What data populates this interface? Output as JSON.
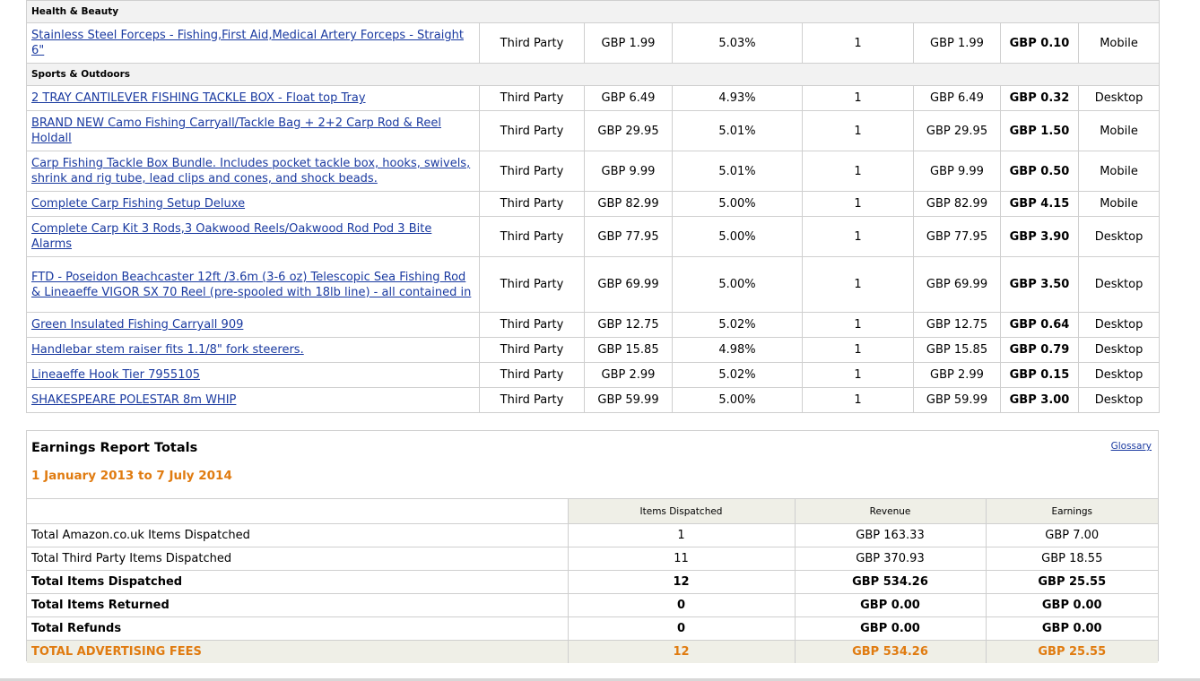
{
  "categories": [
    {
      "name": "Health & Beauty",
      "items": [
        {
          "title": "Stainless Steel Forceps - Fishing,First Aid,Medical Artery Forceps - Straight 6\"",
          "seller": "Third Party",
          "price": "GBP 1.99",
          "rate": "5.03%",
          "qty": "1",
          "revenue": "GBP 1.99",
          "earnings": "GBP 0.10",
          "device": "Mobile"
        }
      ]
    },
    {
      "name": "Sports & Outdoors",
      "items": [
        {
          "title": "2 TRAY CANTILEVER FISHING TACKLE BOX - Float top Tray",
          "seller": "Third Party",
          "price": "GBP 6.49",
          "rate": "4.93%",
          "qty": "1",
          "revenue": "GBP 6.49",
          "earnings": "GBP 0.32",
          "device": "Desktop"
        },
        {
          "title": "BRAND NEW Camo Fishing Carryall/Tackle Bag + 2+2 Carp Rod & Reel Holdall",
          "seller": "Third Party",
          "price": "GBP 29.95",
          "rate": "5.01%",
          "qty": "1",
          "revenue": "GBP 29.95",
          "earnings": "GBP 1.50",
          "device": "Mobile"
        },
        {
          "title": "Carp Fishing Tackle Box Bundle. Includes pocket tackle box, hooks, swivels, shrink and rig tube, lead clips and cones, and shock beads.",
          "seller": "Third Party",
          "price": "GBP 9.99",
          "rate": "5.01%",
          "qty": "1",
          "revenue": "GBP 9.99",
          "earnings": "GBP 0.50",
          "device": "Mobile"
        },
        {
          "title": "Complete Carp Fishing Setup Deluxe",
          "seller": "Third Party",
          "price": "GBP 82.99",
          "rate": "5.00%",
          "qty": "1",
          "revenue": "GBP 82.99",
          "earnings": "GBP 4.15",
          "device": "Mobile"
        },
        {
          "title": "Complete Carp Kit 3 Rods,3 Oakwood Reels/Oakwood Rod Pod 3 Bite Alarms",
          "seller": "Third Party",
          "price": "GBP 77.95",
          "rate": "5.00%",
          "qty": "1",
          "revenue": "GBP 77.95",
          "earnings": "GBP 3.90",
          "device": "Desktop"
        },
        {
          "title": "FTD - Poseidon Beachcaster 12ft /3.6m (3-6 oz) Telescopic Sea Fishing Rod & Lineaeffe VIGOR SX 70 Reel (pre-spooled with 18lb line) - all contained in",
          "seller": "Third Party",
          "price": "GBP 69.99",
          "rate": "5.00%",
          "qty": "1",
          "revenue": "GBP 69.99",
          "earnings": "GBP 3.50",
          "device": "Desktop"
        },
        {
          "title": "Green Insulated Fishing Carryall 909",
          "seller": "Third Party",
          "price": "GBP 12.75",
          "rate": "5.02%",
          "qty": "1",
          "revenue": "GBP 12.75",
          "earnings": "GBP 0.64",
          "device": "Desktop"
        },
        {
          "title": "Handlebar stem raiser fits 1.1/8\" fork steerers.",
          "seller": "Third Party",
          "price": "GBP 15.85",
          "rate": "4.98%",
          "qty": "1",
          "revenue": "GBP 15.85",
          "earnings": "GBP 0.79",
          "device": "Desktop"
        },
        {
          "title": "Lineaeffe Hook Tier 7955105",
          "seller": "Third Party",
          "price": "GBP 2.99",
          "rate": "5.02%",
          "qty": "1",
          "revenue": "GBP 2.99",
          "earnings": "GBP 0.15",
          "device": "Desktop"
        },
        {
          "title": "SHAKESPEARE POLESTAR 8m WHIP",
          "seller": "Third Party",
          "price": "GBP 59.99",
          "rate": "5.00%",
          "qty": "1",
          "revenue": "GBP 59.99",
          "earnings": "GBP 3.00",
          "device": "Desktop"
        }
      ]
    }
  ],
  "totals": {
    "title": "Earnings Report Totals",
    "date_range": "1 January 2013 to 7 July 2014",
    "glossary_label": "Glossary",
    "headers": [
      "",
      "Items Dispatched",
      "Revenue",
      "Earnings"
    ],
    "rows": [
      {
        "label": "Total Amazon.co.uk Items Dispatched",
        "items": "1",
        "revenue": "GBP 163.33",
        "earnings": "GBP 7.00",
        "style": "normal"
      },
      {
        "label": "Total Third Party Items Dispatched",
        "items": "11",
        "revenue": "GBP 370.93",
        "earnings": "GBP 18.55",
        "style": "normal"
      },
      {
        "label": "Total Items Dispatched",
        "items": "12",
        "revenue": "GBP 534.26",
        "earnings": "GBP 25.55",
        "style": "bold"
      },
      {
        "label": "Total Items Returned",
        "items": "0",
        "revenue": "GBP 0.00",
        "earnings": "GBP 0.00",
        "style": "bold"
      },
      {
        "label": "Total Refunds",
        "items": "0",
        "revenue": "GBP 0.00",
        "earnings": "GBP 0.00",
        "style": "bold"
      },
      {
        "label": "TOTAL ADVERTISING FEES",
        "items": "12",
        "revenue": "GBP 534.26",
        "earnings": "GBP 25.55",
        "style": "adfees"
      }
    ]
  },
  "colors": {
    "link": "#1a3aa0",
    "accent_orange": "#e07b10",
    "header_bg": "#efefe7",
    "border": "#cfcfcf"
  }
}
